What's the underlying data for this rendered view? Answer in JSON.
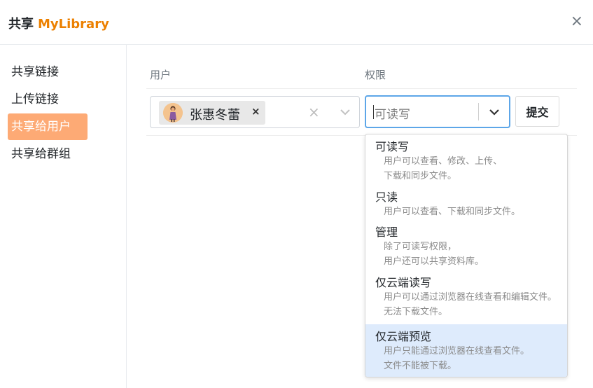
{
  "header": {
    "title": "共享",
    "library": "MyLibrary",
    "close_glyph": "×"
  },
  "sidebar": {
    "items": [
      {
        "label": "共享链接",
        "active": false
      },
      {
        "label": "上传链接",
        "active": false
      },
      {
        "label": "共享给用户",
        "active": true
      },
      {
        "label": "共享给群组",
        "active": false
      }
    ]
  },
  "table": {
    "col_user": "用户",
    "col_permission": "权限"
  },
  "user_select": {
    "selected_user": "张惠冬蕾",
    "remove_glyph": "×",
    "clear_glyph": "×",
    "avatar_icon": "person-avatar"
  },
  "permission_select": {
    "value": "可读写",
    "dropdown_icon": "chevron-down-icon"
  },
  "submit_label": "提交",
  "menu": {
    "options": [
      {
        "title": "可读写",
        "desc": [
          "用户可以查看、修改、上传、",
          "下载和同步文件。"
        ],
        "highlighted": false
      },
      {
        "title": "只读",
        "desc": [
          "用户可以查看、下载和同步文件。"
        ],
        "highlighted": false
      },
      {
        "title": "管理",
        "desc": [
          "除了可读写权限，",
          "用户还可以共享资料库。"
        ],
        "highlighted": false
      },
      {
        "title": "仅云端读写",
        "desc": [
          "用户可以通过浏览器在线查看和编辑文件。",
          "无法下载文件。"
        ],
        "highlighted": false
      },
      {
        "title": "仅云端预览",
        "desc": [
          "用户只能通过浏览器在线查看文件。",
          "文件不能被下载。"
        ],
        "highlighted": true
      }
    ]
  },
  "colors": {
    "accent": "#ec8000",
    "active_nav": "#fdaa75",
    "focus_border": "#5da6e8",
    "highlight": "#deebfc"
  }
}
